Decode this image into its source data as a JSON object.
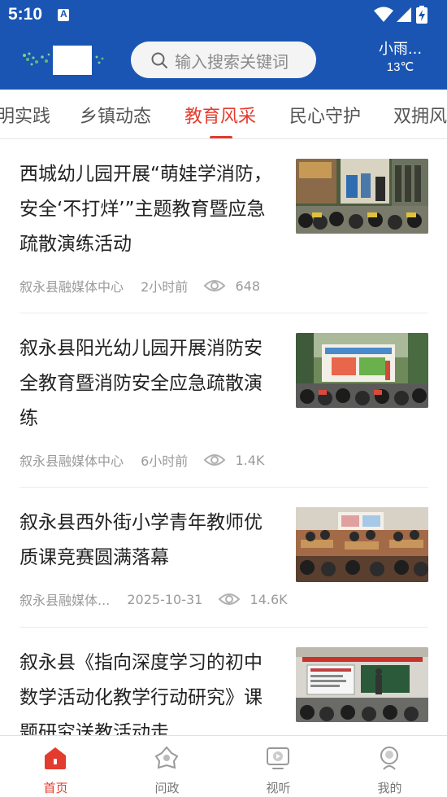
{
  "status_bar": {
    "time": "5:10",
    "icons": [
      "notification-a-icon",
      "wifi-icon",
      "signal-icon",
      "battery-charging-icon"
    ]
  },
  "header": {
    "search_placeholder": "输入搜索关键词",
    "weather": {
      "desc": "小雨...",
      "temp": "13℃"
    }
  },
  "tabs": [
    {
      "label": "明实践",
      "active": false
    },
    {
      "label": "乡镇动态",
      "active": false
    },
    {
      "label": "教育风采",
      "active": true
    },
    {
      "label": "民心守护",
      "active": false
    },
    {
      "label": "双拥风",
      "active": false
    }
  ],
  "articles": [
    {
      "title": "西城幼儿园开展“萌娃学消防，安全‘不打烊’”主题教育暨应急疏散演练活动",
      "source": "叙永县融媒体中心",
      "time": "2小时前",
      "views": "648",
      "thumb": "fire-drill-kindergarten-photo"
    },
    {
      "title": "叙永县阳光幼儿园开展消防安全教育暨消防安全应急疏散演练",
      "source": "叙永县融媒体中心",
      "time": "6小时前",
      "views": "1.4K",
      "thumb": "fire-safety-class-photo"
    },
    {
      "title": "叙永县西外街小学青年教师优质课竞赛圆满落幕",
      "source": "叙永县融媒体...",
      "time": "2025-10-31",
      "views": "14.6K",
      "thumb": "classroom-competition-photo"
    },
    {
      "title": "叙永县《指向深度学习的初中数学活动化教学行动研究》课题研究送教活动走",
      "thumb": "math-research-lecture-photo"
    }
  ],
  "bottom_nav": [
    {
      "label": "首页",
      "icon": "home-icon",
      "active": true
    },
    {
      "label": "问政",
      "icon": "inquiry-icon",
      "active": false
    },
    {
      "label": "视听",
      "icon": "video-icon",
      "active": false
    },
    {
      "label": "我的",
      "icon": "profile-icon",
      "active": false
    }
  ],
  "colors": {
    "brand_blue": "#1a55b3",
    "accent_red": "#e33b2e",
    "meta_gray": "#9a9a9a"
  }
}
